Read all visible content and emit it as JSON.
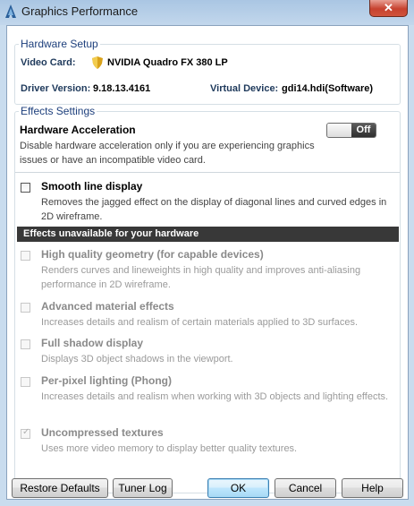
{
  "window": {
    "title": "Graphics Performance",
    "close_glyph": "✕"
  },
  "hardware": {
    "legend": "Hardware Setup",
    "video_card_label": "Video Card:",
    "video_card_value": "NVIDIA Quadro FX 380 LP",
    "driver_label": "Driver Version:",
    "driver_value": "9.18.13.4161",
    "virtual_label": "Virtual Device:",
    "virtual_value": "gdi14.hdi(Software)"
  },
  "effects": {
    "legend": "Effects Settings",
    "hw_accel_title": "Hardware Acceleration",
    "hw_accel_desc": "Disable hardware acceleration only if you are experiencing graphics issues or have an incompatible video card.",
    "toggle_label": "Off",
    "smooth_title": "Smooth line display",
    "smooth_desc": "Removes the jagged effect on the display of diagonal lines and curved edges in 2D wireframe.",
    "unavailable_banner": "Effects unavailable for your hardware",
    "options": [
      {
        "title": "High quality geometry (for capable devices)",
        "desc": "Renders curves and lineweights in high quality and improves anti-aliasing performance in 2D wireframe.",
        "checked": false
      },
      {
        "title": "Advanced material effects",
        "desc": "Increases details and realism of certain materials applied to 3D surfaces.",
        "checked": false
      },
      {
        "title": "Full shadow display",
        "desc": "Displays 3D object shadows in the viewport.",
        "checked": false
      },
      {
        "title": "Per-pixel lighting (Phong)",
        "desc": "Increases details and realism when working with 3D objects and lighting effects.",
        "checked": false
      },
      {
        "title": "Uncompressed textures",
        "desc": "Uses more video memory to display better quality textures.",
        "checked": true
      }
    ]
  },
  "buttons": {
    "restore": "Restore Defaults",
    "tuner": "Tuner Log",
    "ok": "OK",
    "cancel": "Cancel",
    "help": "Help"
  },
  "icons": {
    "app": "autocad-a-icon",
    "video_card": "shield-icon",
    "check": "✓"
  },
  "colors": {
    "banner": "#383838",
    "legend": "#1d3f7c",
    "title_bar": "#aac6e3"
  }
}
